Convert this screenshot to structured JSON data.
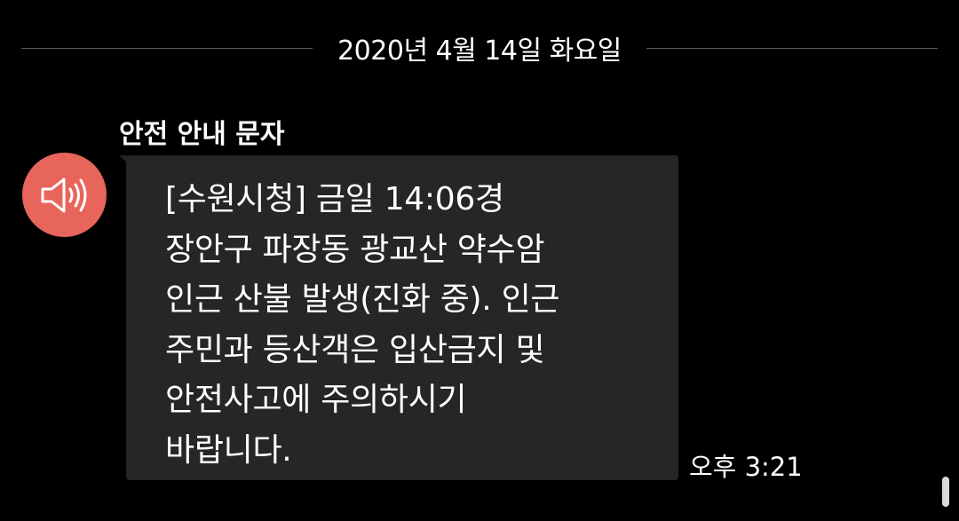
{
  "date_divider": {
    "text": "2020년 4월 14일 화요일"
  },
  "sender": {
    "name": "안전 안내 문자",
    "avatar_icon": "speaker-icon",
    "avatar_color": "#e8655b"
  },
  "message": {
    "text": "[수원시청] 금일 14:06경\n장안구 파장동 광교산 약수암\n인근 산불 발생(진화 중). 인근\n주민과 등산객은 입산금지 및\n안전사고에 주의하시기\n바랍니다.",
    "bubble_color": "#262626",
    "timestamp": "오후 3:21"
  }
}
